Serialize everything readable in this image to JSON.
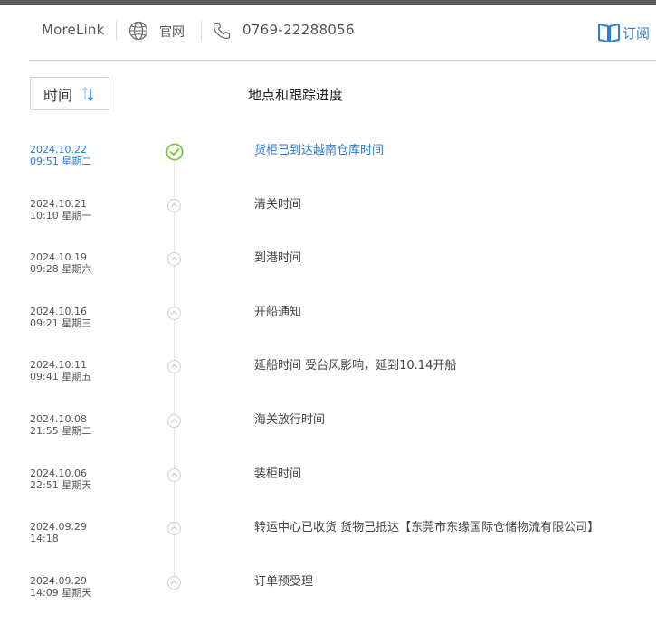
{
  "header": {
    "brand": "MoreLink",
    "site_link": "官网",
    "phone": "0769-22288056",
    "subscribe_label": "订阅"
  },
  "sort_button": {
    "label": "时间"
  },
  "column_title": "地点和跟踪进度",
  "colors": {
    "accent": "#2b7fd6",
    "success": "#7ac943",
    "muted_dot": "#cfcfcf"
  },
  "events": [
    {
      "date": "2024.10.22",
      "time": "09:51 星期二",
      "desc": "货柜已到达越南仓库时间",
      "status": "done"
    },
    {
      "date": "2024.10.21",
      "time": "10:10 星期一",
      "desc": "清关时间",
      "status": "past"
    },
    {
      "date": "2024.10.19",
      "time": "09:28 星期六",
      "desc": "到港时间",
      "status": "past"
    },
    {
      "date": "2024.10.16",
      "time": "09:21 星期三",
      "desc": "开船通知",
      "status": "past"
    },
    {
      "date": "2024.10.11",
      "time": "09:41 星期五",
      "desc": "延船时间 受台风影响，延到10.14开船",
      "status": "past"
    },
    {
      "date": "2024.10.08",
      "time": "21:55 星期二",
      "desc": "海关放行时间",
      "status": "past"
    },
    {
      "date": "2024.10.06",
      "time": "22:51 星期天",
      "desc": "装柜时间",
      "status": "past"
    },
    {
      "date": "2024.09.29",
      "time": "14:18",
      "desc": "转运中心已收货 货物已抵达【东莞市东缘国际仓储物流有限公司】",
      "status": "past"
    },
    {
      "date": "2024.09.29",
      "time": "14:09 星期天",
      "desc": "订单预受理",
      "status": "past"
    }
  ]
}
